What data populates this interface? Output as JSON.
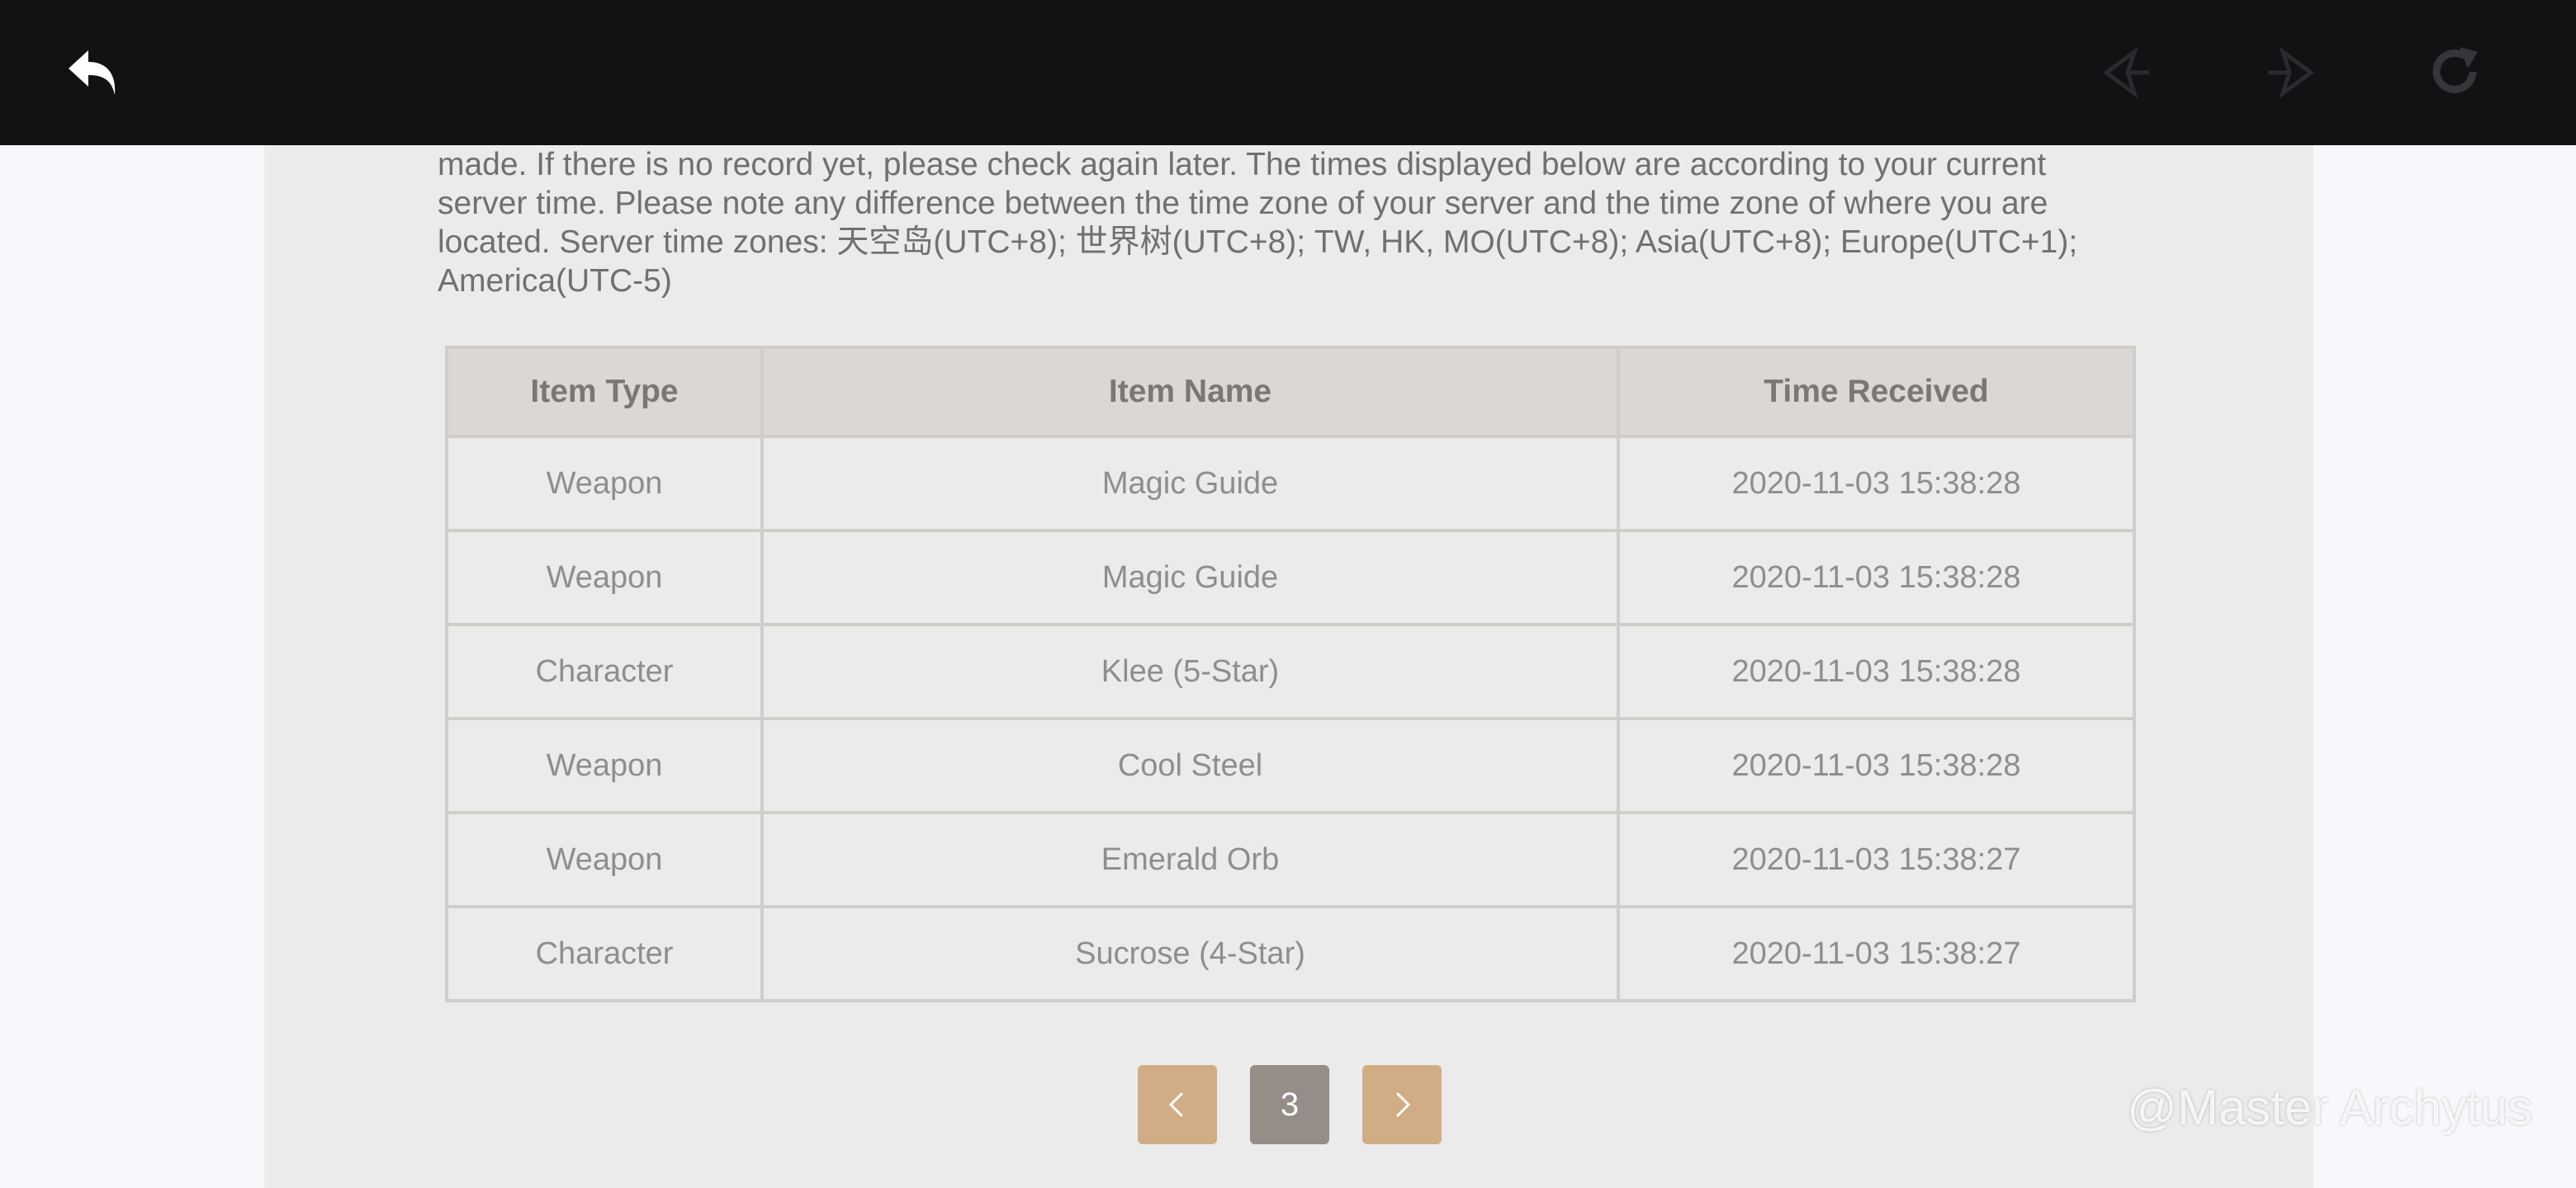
{
  "toolbar": {
    "back_icon": "back-arrow-icon",
    "prev_icon": "prev-page-icon",
    "next_icon": "next-page-icon",
    "refresh_icon": "refresh-icon"
  },
  "intro": {
    "lines": [
      "made. If there is no record yet, please check again later. The times displayed below are according to your current",
      "server time. Please note any difference between the time zone of your server and the time zone of where you are",
      "located. Server time zones: 天空岛(UTC+8); 世界树(UTC+8); TW, HK, MO(UTC+8); Asia(UTC+8); Europe(UTC+1);",
      "America(UTC-5)"
    ]
  },
  "table": {
    "headers": [
      "Item Type",
      "Item Name",
      "Time Received"
    ],
    "rows": [
      {
        "type": "Weapon",
        "name": "Magic Guide",
        "time": "2020-11-03 15:38:28"
      },
      {
        "type": "Weapon",
        "name": "Magic Guide",
        "time": "2020-11-03 15:38:28"
      },
      {
        "type": "Character",
        "name": "Klee (5-Star)",
        "time": "2020-11-03 15:38:28"
      },
      {
        "type": "Weapon",
        "name": "Cool Steel",
        "time": "2020-11-03 15:38:28"
      },
      {
        "type": "Weapon",
        "name": "Emerald Orb",
        "time": "2020-11-03 15:38:27"
      },
      {
        "type": "Character",
        "name": "Sucrose (4-Star)",
        "time": "2020-11-03 15:38:27"
      }
    ]
  },
  "pagination": {
    "prev_label": "<",
    "current_page": "3",
    "next_label": ">"
  },
  "colors": {
    "five_star": "#c3703a",
    "four_star": "#a15fd6",
    "pager_button": "#d1ad85",
    "pager_current": "#958d87"
  },
  "watermark": "@Master Archytus"
}
